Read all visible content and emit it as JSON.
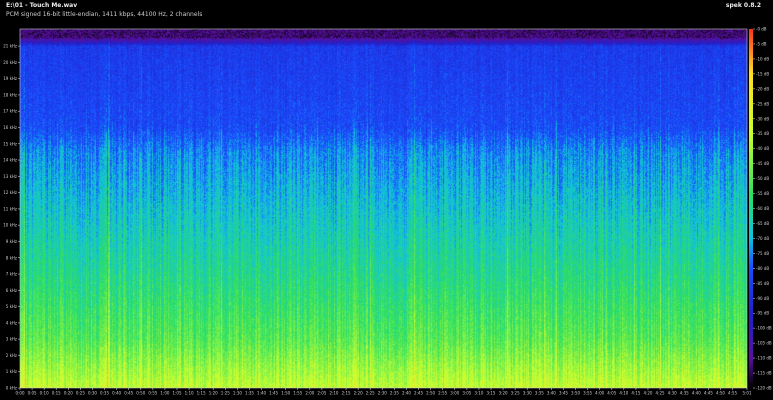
{
  "header": {
    "file_title": "E:\\01 - Touch Me.wav",
    "format_info": "PCM signed 16-bit little-endian, 1411 kbps, 44100 Hz, 2 channels",
    "app_name": "spek 0.8.2"
  },
  "chart_data": {
    "type": "heatmap",
    "title": "E:\\01 - Touch Me.wav",
    "subtitle": "PCM signed 16-bit little-endian, 1411 kbps, 44100 Hz, 2 channels",
    "xlabel": "",
    "ylabel": "",
    "x_range_seconds": [
      0,
      301
    ],
    "x_tick_labels": [
      "0:00",
      "0:05",
      "0:10",
      "0:15",
      "0:20",
      "0:25",
      "0:30",
      "0:35",
      "0:40",
      "0:45",
      "0:50",
      "0:55",
      "1:00",
      "1:05",
      "1:10",
      "1:15",
      "1:20",
      "1:25",
      "1:30",
      "1:35",
      "1:40",
      "1:45",
      "1:50",
      "1:55",
      "2:00",
      "2:05",
      "2:10",
      "2:15",
      "2:20",
      "2:25",
      "2:30",
      "2:35",
      "2:40",
      "2:45",
      "2:50",
      "2:55",
      "3:00",
      "3:05",
      "3:10",
      "3:15",
      "3:20",
      "3:25",
      "3:30",
      "3:35",
      "3:40",
      "3:45",
      "3:50",
      "3:55",
      "4:00",
      "4:05",
      "4:10",
      "4:15",
      "4:20",
      "4:25",
      "4:30",
      "4:35",
      "4:40",
      "4:45",
      "4:50",
      "4:55",
      "5:01"
    ],
    "y_range_khz": [
      0,
      22.05
    ],
    "y_tick_labels": [
      "0 kHz",
      "1 kHz",
      "2 kHz",
      "3 kHz",
      "4 kHz",
      "5 kHz",
      "6 kHz",
      "7 kHz",
      "8 kHz",
      "9 kHz",
      "10 kHz",
      "11 kHz",
      "12 kHz",
      "13 kHz",
      "14 kHz",
      "15 kHz",
      "16 kHz",
      "17 kHz",
      "18 kHz",
      "19 kHz",
      "20 kHz",
      "21 kHz"
    ],
    "colorbar_range_db": [
      -120,
      0
    ],
    "colorbar_tick_labels": [
      "-0 dB",
      "-5 dB",
      "-10 dB",
      "-15 dB",
      "-20 dB",
      "-25 dB",
      "-30 dB",
      "-35 dB",
      "-40 dB",
      "-45 dB",
      "-50 dB",
      "-55 dB",
      "-60 dB",
      "-65 dB",
      "-70 dB",
      "-75 dB",
      "-80 dB",
      "-85 dB",
      "-90 dB",
      "-95 dB",
      "-100 dB",
      "-105 dB",
      "-110 dB",
      "-115 dB",
      "-120 dB"
    ],
    "colormap_db_to_color": [
      {
        "db": 0,
        "color": "#ff3020"
      },
      {
        "db": -15,
        "color": "#ffe028"
      },
      {
        "db": -35,
        "color": "#c8ff30"
      },
      {
        "db": -55,
        "color": "#30e060"
      },
      {
        "db": -70,
        "color": "#10c0e0"
      },
      {
        "db": -80,
        "color": "#1a4dff"
      },
      {
        "db": -95,
        "color": "#2020c8"
      },
      {
        "db": -110,
        "color": "#5a10a0"
      },
      {
        "db": -120,
        "color": "#000000"
      }
    ],
    "spectral_profile_db_by_khz": [
      {
        "khz": 0,
        "db": -35
      },
      {
        "khz": 3,
        "db": -50
      },
      {
        "khz": 7,
        "db": -60
      },
      {
        "khz": 11,
        "db": -68
      },
      {
        "khz": 14.5,
        "db": -75
      },
      {
        "khz": 16,
        "db": -82
      },
      {
        "khz": 21,
        "db": -86
      },
      {
        "khz": 21.6,
        "db": -115
      }
    ],
    "grid": false,
    "legend_placement": "right"
  }
}
